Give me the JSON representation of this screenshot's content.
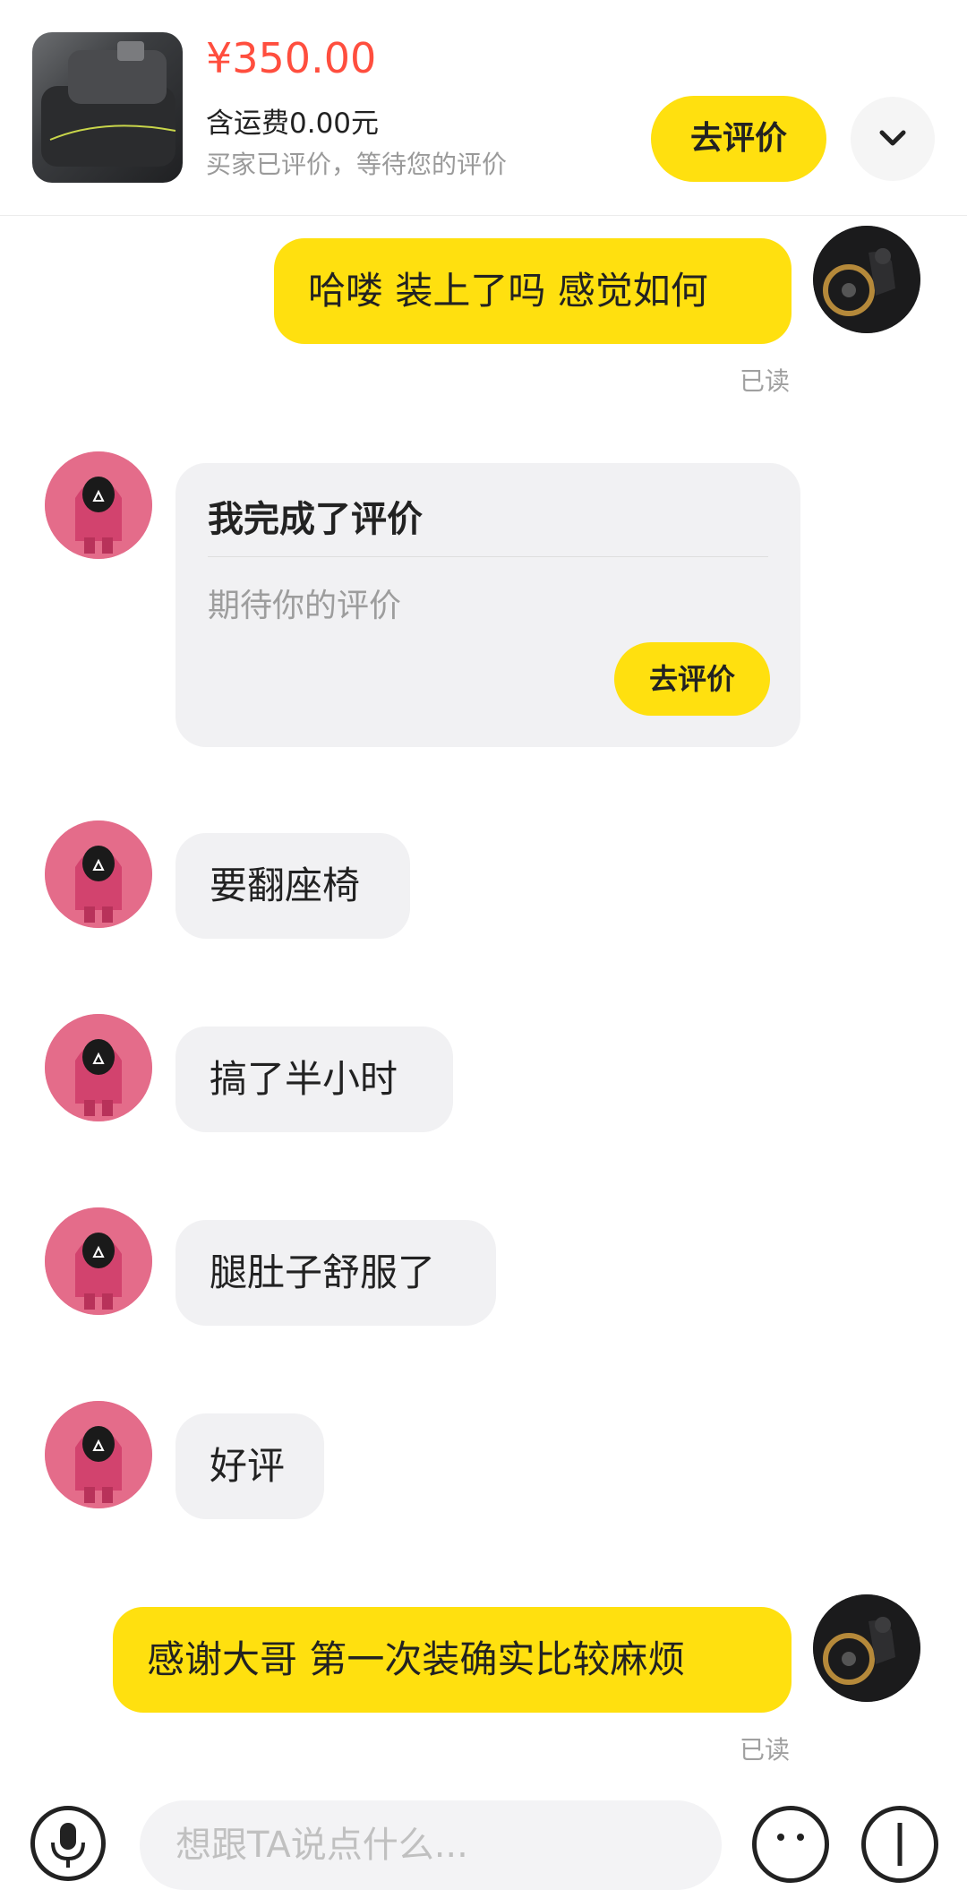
{
  "header": {
    "price": "¥350.00",
    "shipping": "含运费0.00元",
    "status": "买家已评价，等待您的评价",
    "review_button": "去评价"
  },
  "messages": {
    "m1": {
      "text": "哈喽 装上了吗 感觉如何",
      "read": "已读"
    },
    "card": {
      "title": "我完成了评价",
      "subtitle": "期待你的评价",
      "button": "去评价"
    },
    "m2": {
      "text": "要翻座椅"
    },
    "m3": {
      "text": "搞了半小时"
    },
    "m4": {
      "text": "腿肚子舒服了"
    },
    "m5": {
      "text": "好评"
    },
    "m6": {
      "text": "感谢大哥 第一次装确实比较麻烦",
      "read": "已读"
    }
  },
  "input": {
    "placeholder": "想跟TA说点什么..."
  },
  "colors": {
    "accent": "#ffe00f",
    "price": "#ff4e3e",
    "incoming_bubble": "#f1f1f3"
  }
}
